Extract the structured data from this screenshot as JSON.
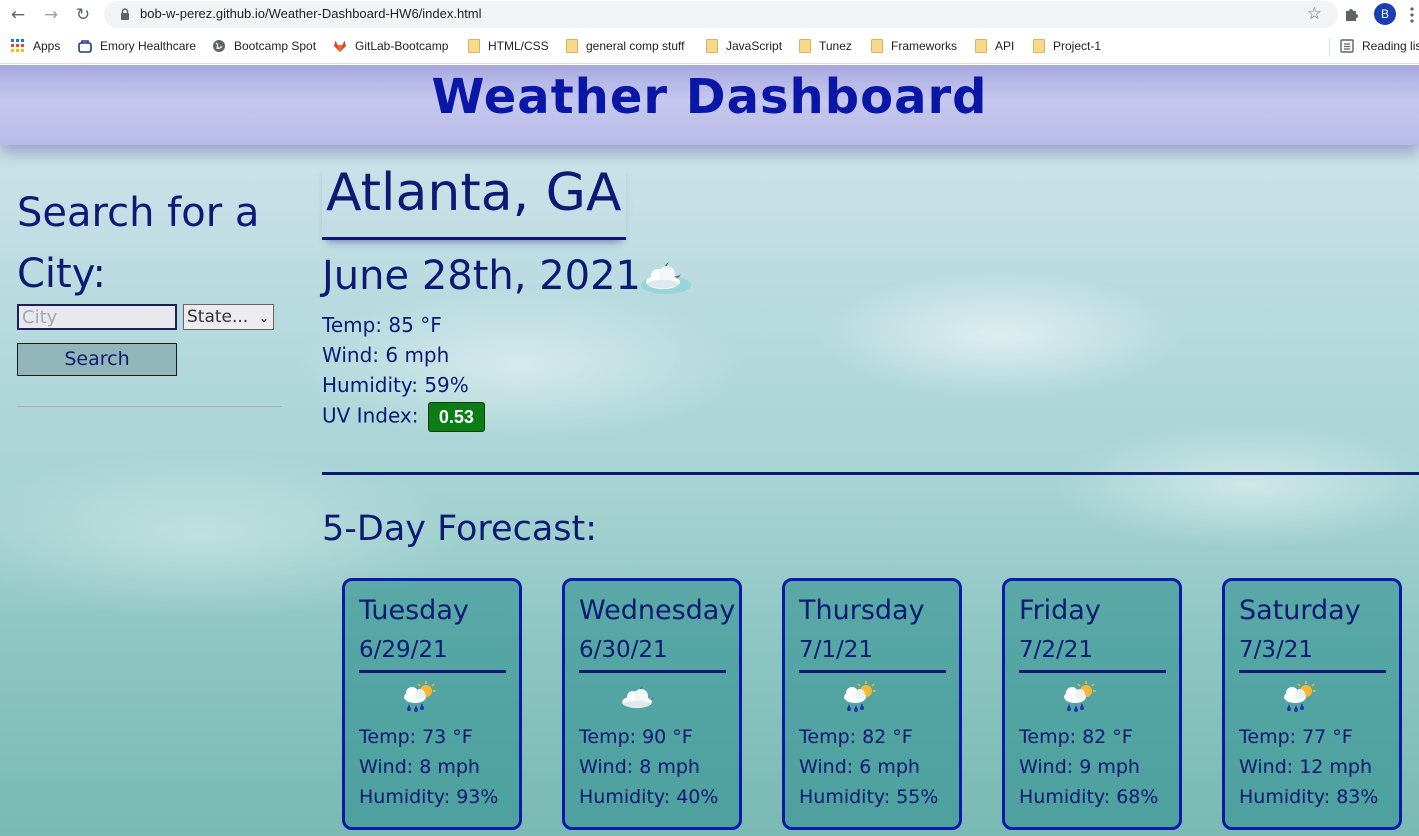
{
  "browser": {
    "url": "bob-w-perez.github.io/Weather-Dashboard-HW6/index.html",
    "profile_initial": "B",
    "bookmarks": [
      {
        "label": "Apps",
        "icon": "apps-grid-icon"
      },
      {
        "label": "Emory Healthcare",
        "icon": "emory-icon"
      },
      {
        "label": "Bootcamp Spot",
        "icon": "globe-icon"
      },
      {
        "label": "GitLab-Bootcamp",
        "icon": "gitlab-icon"
      },
      {
        "label": "HTML/CSS",
        "icon": "folder-icon"
      },
      {
        "label": "general comp stuff",
        "icon": "folder-icon"
      },
      {
        "label": "JavaScript",
        "icon": "folder-icon"
      },
      {
        "label": "Tunez",
        "icon": "folder-icon"
      },
      {
        "label": "Frameworks",
        "icon": "folder-icon"
      },
      {
        "label": "API",
        "icon": "folder-icon"
      },
      {
        "label": "Project-1",
        "icon": "folder-icon"
      }
    ],
    "reading_list_label": "Reading lis"
  },
  "header": {
    "title": "Weather Dashboard"
  },
  "sidebar": {
    "heading": "Search for a City:",
    "city_placeholder": "City",
    "state_selected": "State...",
    "search_label": "Search"
  },
  "current": {
    "city": "Atlanta, GA",
    "date": "June 28th, 2021",
    "icon": "cloud-moon-icon",
    "temp": "Temp: 85 °F",
    "wind": "Wind: 6 mph",
    "humidity": "Humidity: 59%",
    "uv_label": "UV Index:",
    "uv_value": "0.53",
    "uv_color": "#0a7d14"
  },
  "forecast": {
    "heading": "5-Day Forecast:",
    "days": [
      {
        "day": "Tuesday",
        "date": "6/29/21",
        "icon": "rain-sun-icon",
        "temp": "Temp: 73 °F",
        "wind": "Wind: 8 mph",
        "humidity": "Humidity: 93%"
      },
      {
        "day": "Wednesday",
        "date": "6/30/21",
        "icon": "cloud-moon-icon",
        "temp": "Temp: 90 °F",
        "wind": "Wind: 8 mph",
        "humidity": "Humidity: 40%"
      },
      {
        "day": "Thursday",
        "date": "7/1/21",
        "icon": "rain-sun-icon",
        "temp": "Temp: 82 °F",
        "wind": "Wind: 6 mph",
        "humidity": "Humidity: 55%"
      },
      {
        "day": "Friday",
        "date": "7/2/21",
        "icon": "rain-sun-icon",
        "temp": "Temp: 82 °F",
        "wind": "Wind: 9 mph",
        "humidity": "Humidity: 68%"
      },
      {
        "day": "Saturday",
        "date": "7/3/21",
        "icon": "rain-sun-icon",
        "temp": "Temp: 77 °F",
        "wind": "Wind: 12 mph",
        "humidity": "Humidity: 83%"
      }
    ]
  },
  "colors": {
    "text": "#0c1a73",
    "title": "#0a16a5",
    "card_border": "#0b1aa8"
  }
}
